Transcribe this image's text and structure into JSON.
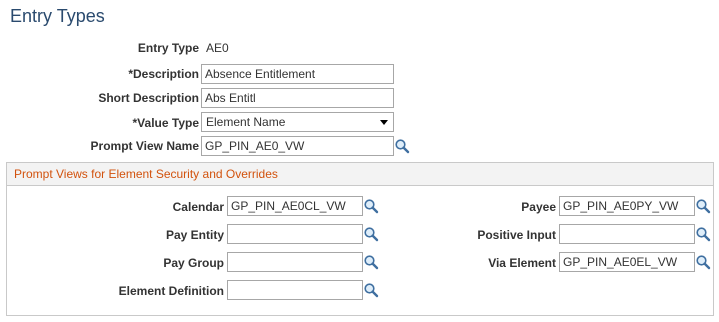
{
  "page": {
    "title": "Entry Types"
  },
  "form": {
    "entry_type": {
      "label": "Entry Type",
      "value": "AE0"
    },
    "description": {
      "label": "*Description",
      "value": "Absence Entitlement"
    },
    "short_description": {
      "label": "Short Description",
      "value": "Abs Entitl"
    },
    "value_type": {
      "label": "*Value Type",
      "value": "Element Name"
    },
    "prompt_view_name": {
      "label": "Prompt View Name",
      "value": "GP_PIN_AE0_VW"
    }
  },
  "prompt_views": {
    "header": "Prompt Views for Element Security and Overrides",
    "calendar": {
      "label": "Calendar",
      "value": "GP_PIN_AE0CL_VW"
    },
    "pay_entity": {
      "label": "Pay Entity",
      "value": ""
    },
    "pay_group": {
      "label": "Pay Group",
      "value": ""
    },
    "element_definition": {
      "label": "Element Definition",
      "value": ""
    },
    "payee": {
      "label": "Payee",
      "value": "GP_PIN_AE0PY_VW"
    },
    "positive_input": {
      "label": "Positive Input",
      "value": ""
    },
    "via_element": {
      "label": "Via Element",
      "value": "GP_PIN_AE0EL_VW"
    }
  },
  "icons": {
    "lookup": "magnifier-lookup-icon"
  },
  "colors": {
    "title": "#2a4a6e",
    "group_header": "#d2520d"
  }
}
